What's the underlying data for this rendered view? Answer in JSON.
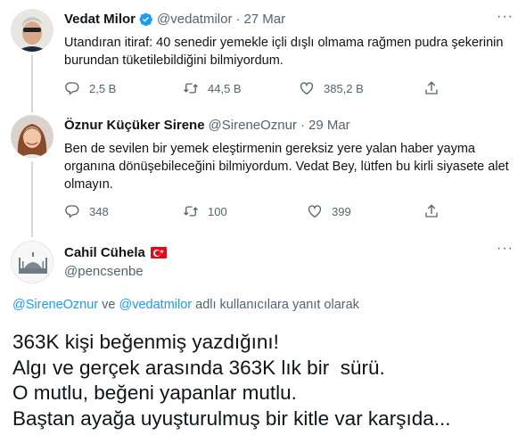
{
  "tweet1": {
    "name": "Vedat Milor",
    "handle": "@vedatmilor",
    "sep": "·",
    "date": "27 Mar",
    "text": "Utandıran itiraf: 40 senedir yemekle içli dışlı olmama rağmen pudra şekerinin burundan tüketilebildiğini bilmiyordum.",
    "replies": "2,5 B",
    "retweets": "44,5 B",
    "likes": "385,2 B"
  },
  "tweet2": {
    "name": "Öznur Küçüker Sirene",
    "handle": "@SireneOznur",
    "sep": "·",
    "date": "29 Mar",
    "text": "Ben de sevilen bir yemek eleştirmenin gereksiz yere yalan haber yayma organına dönüşebileceğini bilmiyordum. Vedat Bey, lütfen bu kirli siyasete alet olmayın.",
    "replies": "348",
    "retweets": "100",
    "likes": "399"
  },
  "tweet3": {
    "name": "Cahil Cühela",
    "handle": "@pencsenbe",
    "reply_mention_1": "@SireneOznur",
    "reply_and": " ve ",
    "reply_mention_2": "@vedatmilor",
    "reply_suffix": " adlı kullanıcılara yanıt olarak",
    "lines": [
      "363K kişi beğenmiş yazdığını!",
      "Algı ve gerçek arasında 363K lık bir  sürü.",
      "O mutlu, beğeni yapanlar mutlu.",
      "Baştan ayağa uyuşturulmuş bir kitle var karşıda..."
    ]
  },
  "colors": {
    "accent": "#1d9bf0",
    "muted": "#536471",
    "text": "#0f1419",
    "flag_red": "#e30a17"
  },
  "icons": [
    "reply-icon",
    "retweet-icon",
    "like-icon",
    "share-icon",
    "verified-icon",
    "more-icon",
    "turkish-flag-icon"
  ]
}
